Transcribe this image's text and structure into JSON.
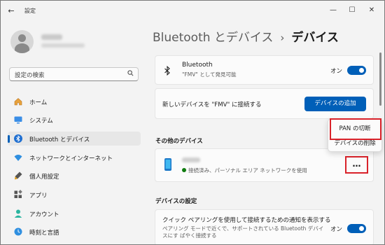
{
  "window": {
    "title": "設定",
    "back_icon": "←",
    "controls": {
      "minimize": "—",
      "maximize": "☐",
      "close": "✕"
    }
  },
  "search": {
    "placeholder": "設定の検索",
    "icon": "search-icon"
  },
  "sidebar": {
    "items": [
      {
        "label": "ホーム",
        "icon": "home-icon",
        "active": false
      },
      {
        "label": "システム",
        "icon": "system-icon",
        "active": false
      },
      {
        "label": "Bluetooth とデバイス",
        "icon": "bluetooth-icon",
        "active": true
      },
      {
        "label": "ネットワークとインターネット",
        "icon": "wifi-icon",
        "active": false
      },
      {
        "label": "個人用設定",
        "icon": "brush-icon",
        "active": false
      },
      {
        "label": "アプリ",
        "icon": "apps-icon",
        "active": false
      },
      {
        "label": "アカウント",
        "icon": "account-icon",
        "active": false
      },
      {
        "label": "時刻と言語",
        "icon": "clock-icon",
        "active": false
      }
    ]
  },
  "breadcrumb": {
    "parent": "Bluetooth とデバイス",
    "separator": "›",
    "current": "デバイス"
  },
  "bluetooth_card": {
    "title": "Bluetooth",
    "subtitle": "\"FMV\" として発見可能",
    "toggle_label": "オン",
    "toggle_on": true
  },
  "add_device_card": {
    "text": "新しいデバイスを \"FMV\" に接続する",
    "button": "デバイスの追加"
  },
  "other_devices": {
    "section_title": "その他のデバイス",
    "device": {
      "status": "接続済み、パーソナル エリア ネットワークを使用",
      "more_label": "…"
    },
    "context_menu": {
      "items": [
        "PAN の切断",
        "デバイスの削除"
      ]
    }
  },
  "device_settings": {
    "section_title": "デバイスの設定",
    "swift_pair": {
      "title": "クイック ペアリングを使用して接続するための通知を表示する",
      "description": "ペアリング モードで近くで、サポートされている Bluetooth デバイスにす ばやく接続する",
      "toggle_label": "オン",
      "toggle_on": true
    }
  },
  "colors": {
    "accent": "#005fb8",
    "highlight": "#d9222a",
    "status_dot": "#0f7b0f"
  }
}
